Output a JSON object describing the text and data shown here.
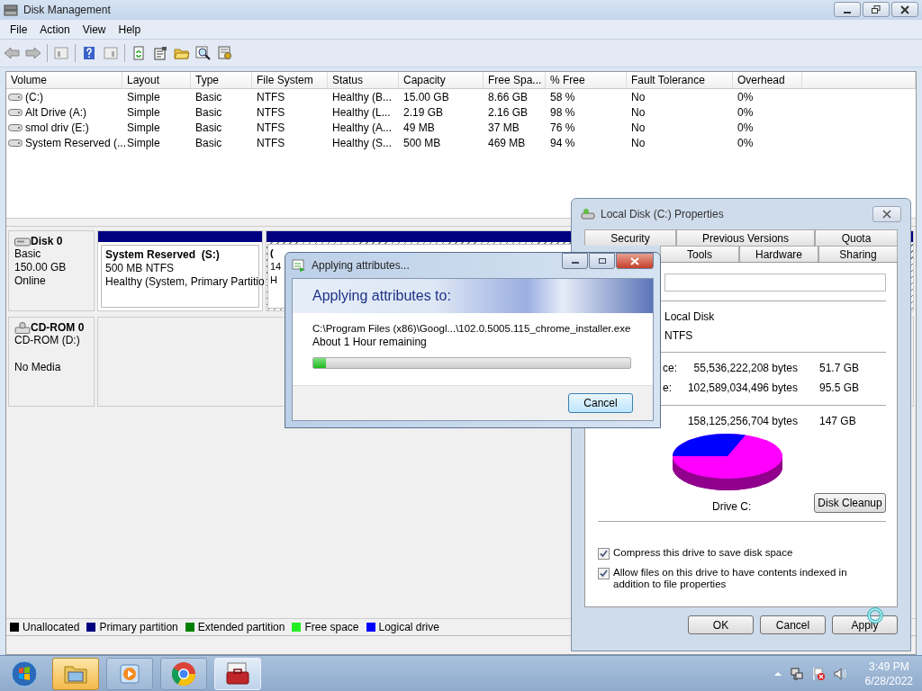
{
  "window": {
    "title": "Disk Management"
  },
  "menu": [
    "File",
    "Action",
    "View",
    "Help"
  ],
  "volumes": {
    "columns": [
      "Volume",
      "Layout",
      "Type",
      "File System",
      "Status",
      "Capacity",
      "Free Spa...",
      "% Free",
      "Fault Tolerance",
      "Overhead"
    ],
    "rows": [
      [
        "(C:)",
        "Simple",
        "Basic",
        "NTFS",
        "Healthy (B...",
        "15.00 GB",
        "8.66 GB",
        "58 %",
        "No",
        "0%"
      ],
      [
        "Alt Drive (A:)",
        "Simple",
        "Basic",
        "NTFS",
        "Healthy (L...",
        "2.19 GB",
        "2.16 GB",
        "98 %",
        "No",
        "0%"
      ],
      [
        "smol driv (E:)",
        "Simple",
        "Basic",
        "NTFS",
        "Healthy (A...",
        "49 MB",
        "37 MB",
        "76 %",
        "No",
        "0%"
      ],
      [
        "System Reserved (...",
        "Simple",
        "Basic",
        "NTFS",
        "Healthy (S...",
        "500 MB",
        "469 MB",
        "94 %",
        "No",
        "0%"
      ]
    ]
  },
  "disks": [
    {
      "kind": "disk",
      "name": "Disk 0",
      "lines": [
        "Basic",
        "150.00 GB",
        "Online"
      ],
      "partitions": [
        {
          "title": "System Reserved  (S:)",
          "lines": [
            "500 MB NTFS",
            "Healthy (System, Primary Partitio"
          ],
          "color": "#000080",
          "selected": false
        },
        {
          "title": "(",
          "lines": [
            "14",
            "H"
          ],
          "color": "#000080",
          "selected": true
        }
      ]
    },
    {
      "kind": "cdrom",
      "name": "CD-ROM 0",
      "lines": [
        "CD-ROM (D:)",
        "No Media"
      ]
    }
  ],
  "legend": [
    {
      "label": "Unallocated",
      "color": "#000000"
    },
    {
      "label": "Primary partition",
      "color": "#000080"
    },
    {
      "label": "Extended partition",
      "color": "#008000"
    },
    {
      "label": "Free space",
      "color": "#22ee22"
    },
    {
      "label": "Logical drive",
      "color": "#0000ff"
    }
  ],
  "properties": {
    "title": "Local Disk (C:) Properties",
    "tab_rows": [
      [
        {
          "label": "Security",
          "selected": false
        },
        {
          "label": "Previous Versions",
          "selected": false
        },
        {
          "label": "Quota",
          "selected": false
        }
      ],
      [
        {
          "label": "Tools",
          "selected": false
        },
        {
          "label": "Hardware",
          "selected": false
        },
        {
          "label": "Sharing",
          "selected": false
        }
      ]
    ],
    "type_value": "Local Disk",
    "fs_value": "NTFS",
    "space_rows": [
      {
        "label": "ce:",
        "bytes": "55,536,222,208 bytes",
        "size": "51.7 GB"
      },
      {
        "label": "e:",
        "bytes": "102,589,034,496 bytes",
        "size": "95.5 GB"
      },
      {
        "bytes": "158,125,256,704 bytes",
        "size": "147 GB"
      }
    ],
    "drive_label": "Drive C:",
    "cleanup": "Disk Cleanup",
    "options": [
      {
        "label": "Compress this drive to save disk space",
        "checked": true
      },
      {
        "label": "Allow files on this drive to have contents indexed in addition to file properties",
        "checked": true
      }
    ],
    "buttons": [
      "OK",
      "Cancel",
      "Apply"
    ]
  },
  "applying": {
    "title": "Applying attributes...",
    "heading": "Applying attributes to:",
    "file": "C:\\Program Files (x86)\\Googl...\\102.0.5005.115_chrome_installer.exe",
    "remaining": "About 1 Hour remaining",
    "progress": {
      "level": 0.04
    },
    "cancel": "Cancel"
  },
  "taskbar": {
    "apps": [
      {
        "kind": "explorer",
        "highlighted": true,
        "selected": false
      },
      {
        "kind": "media",
        "highlighted": false,
        "selected": false
      },
      {
        "kind": "chrome",
        "highlighted": false,
        "selected": false
      },
      {
        "kind": "toolbox",
        "highlighted": false,
        "selected": true
      }
    ],
    "time": "3:49 PM",
    "date": "6/28/2022"
  }
}
